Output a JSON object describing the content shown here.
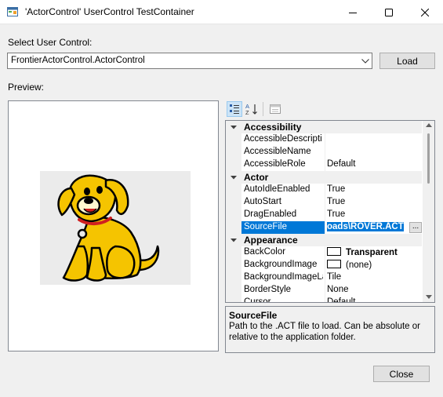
{
  "window": {
    "title": "'ActorControl' UserControl TestContainer",
    "icons": {
      "app": "form-icon",
      "minimize": "minimize-icon",
      "maximize": "maximize-icon",
      "close": "close-icon"
    }
  },
  "select_label": "Select User Control:",
  "combo": {
    "value": "FrontierActorControl.ActorControl",
    "arrow_icon": "chevron-down-icon"
  },
  "load_label": "Load",
  "preview_label": "Preview:",
  "preview": {
    "image": "cartoon-dog-rover"
  },
  "toolbar": {
    "categorized_icon": "categorized-icon",
    "alphabetical_icon": "alphabetical-sort-icon",
    "pages_icon": "property-pages-icon"
  },
  "grid": {
    "rows": [
      {
        "type": "category",
        "label": "Accessibility"
      },
      {
        "type": "prop",
        "name": "AccessibleDescripti",
        "value": ""
      },
      {
        "type": "prop",
        "name": "AccessibleName",
        "value": ""
      },
      {
        "type": "prop",
        "name": "AccessibleRole",
        "value": "Default"
      },
      {
        "type": "category",
        "label": "Actor"
      },
      {
        "type": "prop",
        "name": "AutoIdleEnabled",
        "value": "True"
      },
      {
        "type": "prop",
        "name": "AutoStart",
        "value": "True"
      },
      {
        "type": "prop",
        "name": "DragEnabled",
        "value": "True"
      },
      {
        "type": "prop",
        "name": "SourceFile",
        "value": "oads\\ROVER.ACT",
        "selected": true,
        "ellipsis": "..."
      },
      {
        "type": "category",
        "label": "Appearance"
      },
      {
        "type": "prop",
        "name": "BackColor",
        "value": "Transparent",
        "swatch": "#ffffff",
        "bold": true
      },
      {
        "type": "prop",
        "name": "BackgroundImage",
        "value": "(none)",
        "swatch": "#ffffff"
      },
      {
        "type": "prop",
        "name": "BackgroundImageLa",
        "value": "Tile"
      },
      {
        "type": "prop",
        "name": "BorderStyle",
        "value": "None"
      },
      {
        "type": "prop",
        "name": "Cursor",
        "value": "Default"
      }
    ]
  },
  "description": {
    "title": "SourceFile",
    "text": "Path to the .ACT file to load. Can be absolute or relative to the application folder."
  },
  "close_label": "Close",
  "colors": {
    "accent": "#0078d7",
    "dog_body": "#f5c400",
    "collar": "#d02020"
  }
}
